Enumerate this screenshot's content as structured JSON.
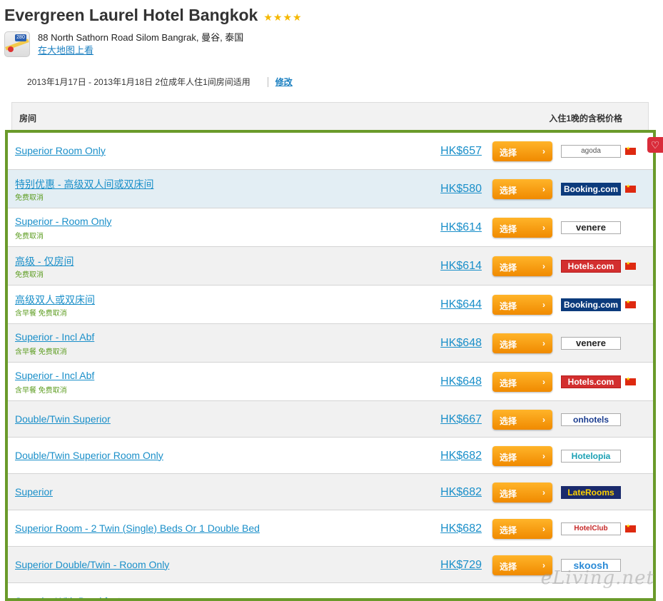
{
  "hotel": {
    "name": "Evergreen Laurel Hotel Bangkok",
    "stars": "★★★★",
    "address": "88 North Sathorn Road Silom Bangrak, 曼谷, 泰国",
    "map_link": "在大地图上看",
    "map_shield": "280"
  },
  "stay": {
    "dates": "2013年1月17日 - 2013年1月18日 2位成年人住1间房间适用",
    "modify_label": "修改"
  },
  "table_header": {
    "room": "房间",
    "price": "入住1晚的含税价格"
  },
  "select_label": "选择",
  "select_chevron": "›",
  "watermark": "eLiving.net",
  "rows": [
    {
      "name": "Superior Room Only",
      "sub": "",
      "price": "HK$657",
      "provider": "agoda",
      "flag": true
    },
    {
      "name": "特别优惠 - 高级双人间或双床间",
      "sub": "免费取消",
      "price": "HK$580",
      "provider": "Booking.com",
      "flag": true
    },
    {
      "name": "Superior - Room Only",
      "sub": "免费取消",
      "price": "HK$614",
      "provider": "venere",
      "flag": false
    },
    {
      "name": "高级 - 仅房间",
      "sub": "免费取消",
      "price": "HK$614",
      "provider": "Hotels.com",
      "flag": true
    },
    {
      "name": "高级双人或双床间",
      "sub": "含早餐 免费取消",
      "price": "HK$644",
      "provider": "Booking.com",
      "flag": true
    },
    {
      "name": "Superior - Incl Abf",
      "sub": "含早餐 免费取消",
      "price": "HK$648",
      "provider": "venere",
      "flag": false
    },
    {
      "name": "Superior - Incl Abf",
      "sub": "含早餐 免费取消",
      "price": "HK$648",
      "provider": "Hotels.com",
      "flag": true
    },
    {
      "name": "Double/Twin Superior",
      "sub": "",
      "price": "HK$667",
      "provider": "onhotels",
      "flag": false
    },
    {
      "name": "Double/Twin Superior Room Only",
      "sub": "",
      "price": "HK$682",
      "provider": "Hotelopia",
      "flag": false
    },
    {
      "name": "Superior",
      "sub": "",
      "price": "HK$682",
      "provider": "LateRooms",
      "flag": false
    },
    {
      "name": "Superior Room - 2 Twin (Single) Beds Or 1 Double Bed",
      "sub": "",
      "price": "HK$682",
      "provider": "HotelClub",
      "flag": true
    },
    {
      "name": "Superior Double/Twin - Room Only",
      "sub": "",
      "price": "HK$729",
      "provider": "skoosh",
      "flag": false
    },
    {
      "name": "Superior With Breakfast",
      "sub": "",
      "price": "",
      "provider": "",
      "flag": false
    }
  ],
  "colors": {
    "accent_green": "#6a9a2a",
    "link_blue": "#1a8fc9",
    "button_orange": "#f59a0c",
    "sub_green": "#5f9e24"
  }
}
